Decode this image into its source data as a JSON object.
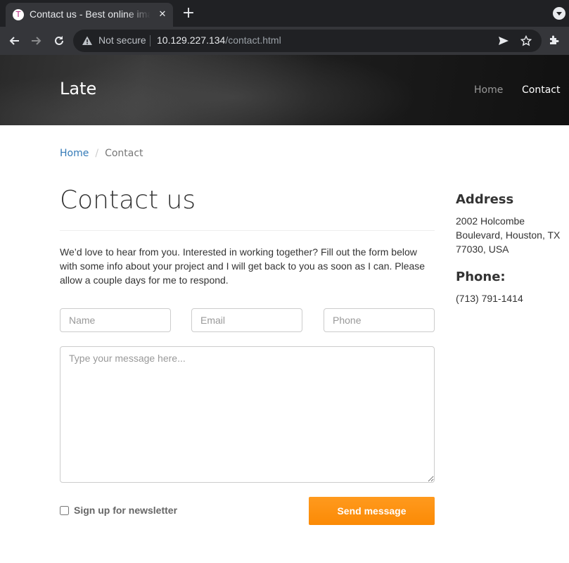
{
  "browser": {
    "tab_title": "Contact us - Best online image tools",
    "tab_favicon": "T",
    "close_glyph": "✕",
    "new_tab_glyph": "+",
    "not_secure_text": "Not secure",
    "url_host": "10.129.227.134",
    "url_path": "/contact.html",
    "icons": [
      "back-arrow-icon",
      "forward-arrow-icon",
      "reload-icon",
      "warning-icon",
      "send-tab-icon",
      "star-icon",
      "extensions-icon"
    ]
  },
  "site": {
    "brand": "Late",
    "nav": [
      {
        "label": "Home",
        "active": false
      },
      {
        "label": "Contact",
        "active": true
      }
    ]
  },
  "breadcrumb": {
    "home": "Home",
    "separator": "/",
    "current": "Contact"
  },
  "page": {
    "title": "Contact us",
    "intro": "We’d love to hear from you. Interested in working together? Fill out the form below with some info about your project and I will get back to you as soon as I can. Please allow a couple days for me to respond."
  },
  "form": {
    "name_placeholder": "Name",
    "email_placeholder": "Email",
    "phone_placeholder": "Phone",
    "message_placeholder": "Type your message here...",
    "newsletter_label": "Sign up for newsletter",
    "newsletter_checked": false,
    "submit_label": "Send message"
  },
  "sidebar": {
    "address_heading": "Address",
    "address_text": "2002 Holcombe Boulevard, Houston, TX 77030, USA",
    "phone_heading": "Phone:",
    "phone_text": "(713) 791-1414"
  },
  "colors": {
    "accent_button": "#fb8a05",
    "link": "#337ab7",
    "header_bg": "#1d1d1d"
  }
}
